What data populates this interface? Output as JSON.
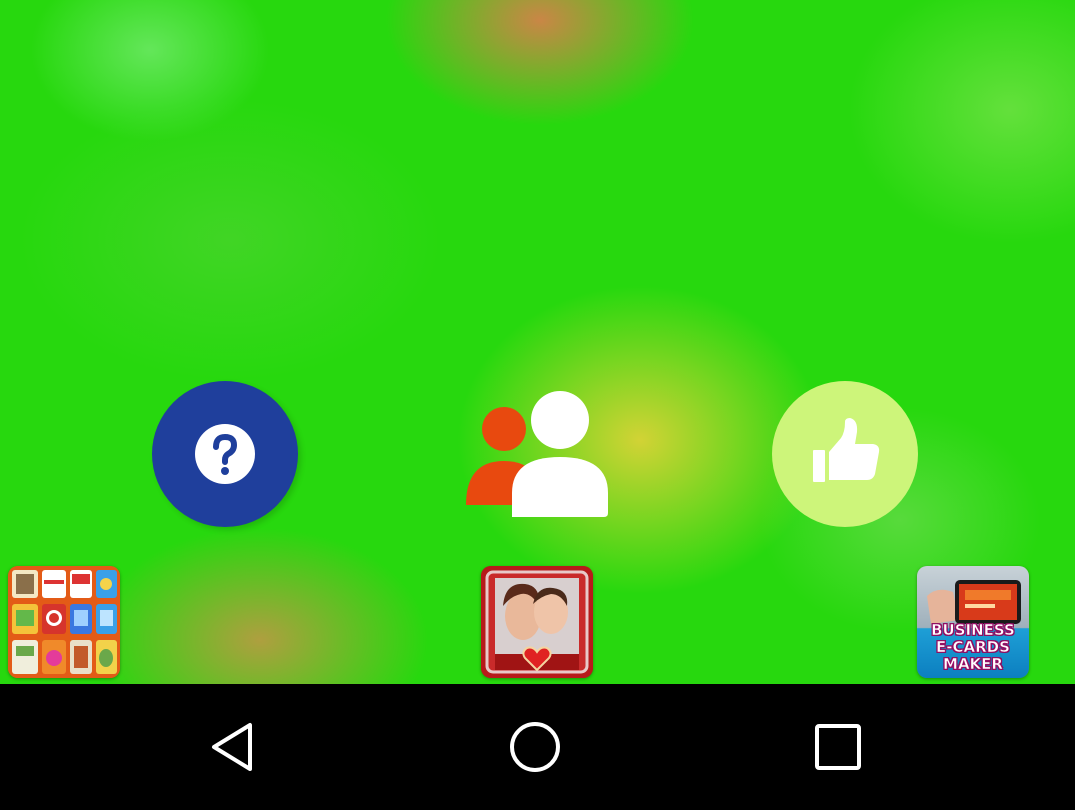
{
  "screen": {
    "type": "android-app-home",
    "colors": {
      "background": "#27d80e",
      "help_button": "#1f3f9c",
      "like_button": "#cdf57a",
      "users_front": "#ffffff",
      "users_back": "#e8490f",
      "nav_bar": "#000000",
      "nav_icons": "#ffffff"
    }
  },
  "actions": {
    "help": {
      "icon": "question-mark-icon"
    },
    "users": {
      "icon": "users-icon"
    },
    "like": {
      "icon": "thumbs-up-icon"
    }
  },
  "promo_apps": [
    {
      "name": "cards-grid",
      "icon": "card-templates-grid-icon"
    },
    {
      "name": "love-photo-frames",
      "icon": "couple-love-frame-icon"
    },
    {
      "name": "business-e-cards-maker",
      "label_lines": [
        "BUSINESS",
        "E-CARDS",
        "MAKER"
      ]
    }
  ],
  "nav_bar": {
    "back": {
      "icon": "back-triangle-icon"
    },
    "home": {
      "icon": "home-circle-icon"
    },
    "recents": {
      "icon": "recents-square-icon"
    }
  }
}
